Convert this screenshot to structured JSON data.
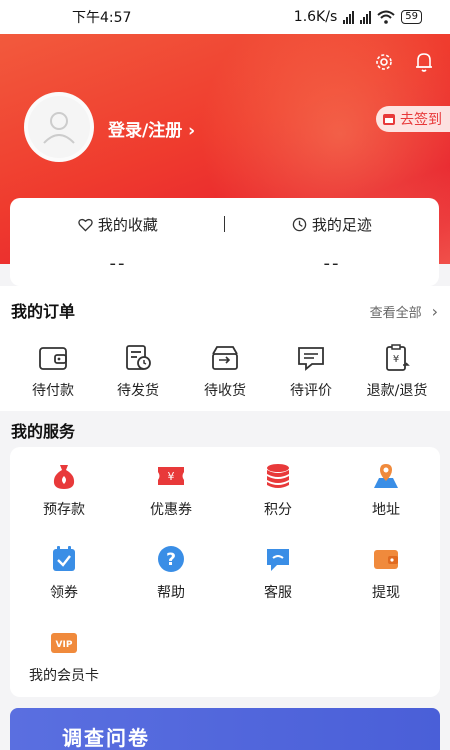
{
  "status_bar": {
    "time": "下午4:57",
    "speed": "1.6K/s",
    "battery": "59"
  },
  "header": {
    "login_label": "登录/注册",
    "signin_label": "去签到"
  },
  "favorites": [
    {
      "label": "我的收藏",
      "value": "--",
      "icon": "heart-icon"
    },
    {
      "label": "我的足迹",
      "value": "--",
      "icon": "clock-icon"
    }
  ],
  "orders": {
    "title": "我的订单",
    "view_all": "查看全部",
    "items": [
      {
        "label": "待付款",
        "icon": "wallet-icon"
      },
      {
        "label": "待发货",
        "icon": "clock-doc-icon"
      },
      {
        "label": "待收货",
        "icon": "box-icon"
      },
      {
        "label": "待评价",
        "icon": "comment-icon"
      },
      {
        "label": "退款/退货",
        "icon": "refund-icon"
      }
    ]
  },
  "services": {
    "title": "我的服务",
    "items": [
      {
        "label": "预存款",
        "icon": "money-bag-icon"
      },
      {
        "label": "优惠券",
        "icon": "coupon-icon"
      },
      {
        "label": "积分",
        "icon": "points-stack-icon"
      },
      {
        "label": "地址",
        "icon": "map-pin-icon"
      },
      {
        "label": "领券",
        "icon": "calendar-check-icon"
      },
      {
        "label": "帮助",
        "icon": "help-icon"
      },
      {
        "label": "客服",
        "icon": "chat-icon"
      },
      {
        "label": "提现",
        "icon": "wallet-cash-icon"
      },
      {
        "label": "我的会员卡",
        "icon": "vip-card-icon"
      }
    ]
  },
  "banner": {
    "text": "调查问卷"
  },
  "colors": {
    "brand_red": "#e8393a",
    "service_red": "#e8393a",
    "service_blue": "#3a8ee6",
    "service_orange": "#f08a3c"
  }
}
